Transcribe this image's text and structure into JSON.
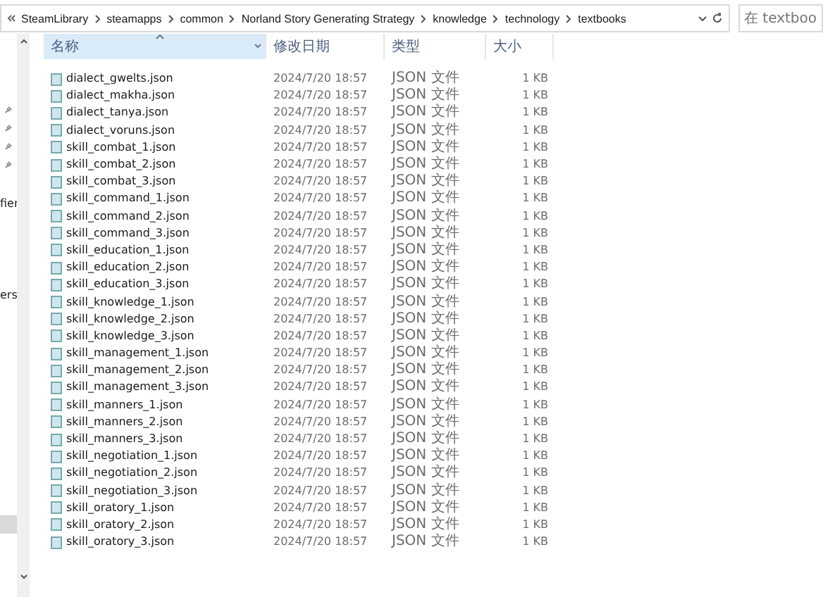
{
  "address_bar": {
    "path": [
      "SteamLibrary",
      "steamapps",
      "common",
      "Norland Story Generating Strategy",
      "knowledge",
      "technology",
      "textbooks"
    ]
  },
  "search": {
    "placeholder": "在 textboo"
  },
  "nav_pane": {
    "items": [
      {
        "label": "fier",
        "selected": false
      },
      {
        "label": "ers",
        "selected": false
      },
      {
        "selected": true
      }
    ]
  },
  "table": {
    "columns": [
      {
        "label": "名称",
        "sorted": true
      },
      {
        "label": "修改日期",
        "sorted": false
      },
      {
        "label": "类型",
        "sorted": false
      },
      {
        "label": "大小",
        "sorted": false
      }
    ],
    "rows": [
      {
        "name": "dialect_gwelts.json",
        "date": "2024/7/20 18:57",
        "type": "JSON 文件",
        "size": "1 KB"
      },
      {
        "name": "dialect_makha.json",
        "date": "2024/7/20 18:57",
        "type": "JSON 文件",
        "size": "1 KB"
      },
      {
        "name": "dialect_tanya.json",
        "date": "2024/7/20 18:57",
        "type": "JSON 文件",
        "size": "1 KB"
      },
      {
        "name": "dialect_voruns.json",
        "date": "2024/7/20 18:57",
        "type": "JSON 文件",
        "size": "1 KB"
      },
      {
        "name": "skill_combat_1.json",
        "date": "2024/7/20 18:57",
        "type": "JSON 文件",
        "size": "1 KB"
      },
      {
        "name": "skill_combat_2.json",
        "date": "2024/7/20 18:57",
        "type": "JSON 文件",
        "size": "1 KB"
      },
      {
        "name": "skill_combat_3.json",
        "date": "2024/7/20 18:57",
        "type": "JSON 文件",
        "size": "1 KB"
      },
      {
        "name": "skill_command_1.json",
        "date": "2024/7/20 18:57",
        "type": "JSON 文件",
        "size": "1 KB"
      },
      {
        "name": "skill_command_2.json",
        "date": "2024/7/20 18:57",
        "type": "JSON 文件",
        "size": "1 KB"
      },
      {
        "name": "skill_command_3.json",
        "date": "2024/7/20 18:57",
        "type": "JSON 文件",
        "size": "1 KB"
      },
      {
        "name": "skill_education_1.json",
        "date": "2024/7/20 18:57",
        "type": "JSON 文件",
        "size": "1 KB"
      },
      {
        "name": "skill_education_2.json",
        "date": "2024/7/20 18:57",
        "type": "JSON 文件",
        "size": "1 KB"
      },
      {
        "name": "skill_education_3.json",
        "date": "2024/7/20 18:57",
        "type": "JSON 文件",
        "size": "1 KB"
      },
      {
        "name": "skill_knowledge_1.json",
        "date": "2024/7/20 18:57",
        "type": "JSON 文件",
        "size": "1 KB"
      },
      {
        "name": "skill_knowledge_2.json",
        "date": "2024/7/20 18:57",
        "type": "JSON 文件",
        "size": "1 KB"
      },
      {
        "name": "skill_knowledge_3.json",
        "date": "2024/7/20 18:57",
        "type": "JSON 文件",
        "size": "1 KB"
      },
      {
        "name": "skill_management_1.json",
        "date": "2024/7/20 18:57",
        "type": "JSON 文件",
        "size": "1 KB"
      },
      {
        "name": "skill_management_2.json",
        "date": "2024/7/20 18:57",
        "type": "JSON 文件",
        "size": "1 KB"
      },
      {
        "name": "skill_management_3.json",
        "date": "2024/7/20 18:57",
        "type": "JSON 文件",
        "size": "1 KB"
      },
      {
        "name": "skill_manners_1.json",
        "date": "2024/7/20 18:57",
        "type": "JSON 文件",
        "size": "1 KB"
      },
      {
        "name": "skill_manners_2.json",
        "date": "2024/7/20 18:57",
        "type": "JSON 文件",
        "size": "1 KB"
      },
      {
        "name": "skill_manners_3.json",
        "date": "2024/7/20 18:57",
        "type": "JSON 文件",
        "size": "1 KB"
      },
      {
        "name": "skill_negotiation_1.json",
        "date": "2024/7/20 18:57",
        "type": "JSON 文件",
        "size": "1 KB"
      },
      {
        "name": "skill_negotiation_2.json",
        "date": "2024/7/20 18:57",
        "type": "JSON 文件",
        "size": "1 KB"
      },
      {
        "name": "skill_negotiation_3.json",
        "date": "2024/7/20 18:57",
        "type": "JSON 文件",
        "size": "1 KB"
      },
      {
        "name": "skill_oratory_1.json",
        "date": "2024/7/20 18:57",
        "type": "JSON 文件",
        "size": "1 KB"
      },
      {
        "name": "skill_oratory_2.json",
        "date": "2024/7/20 18:57",
        "type": "JSON 文件",
        "size": "1 KB"
      },
      {
        "name": "skill_oratory_3.json",
        "date": "2024/7/20 18:57",
        "type": "JSON 文件",
        "size": "1 KB"
      }
    ]
  }
}
